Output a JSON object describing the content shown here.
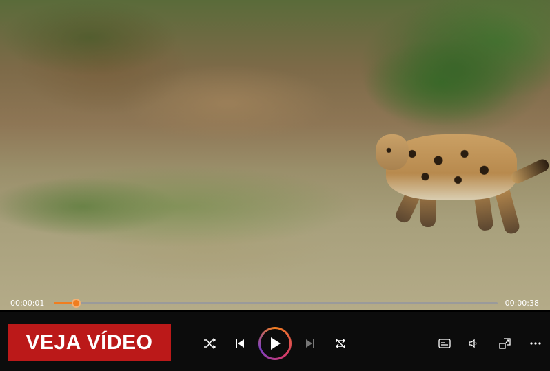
{
  "player": {
    "current_time": "00:00:01",
    "total_time": "00:00:38",
    "progress_fraction": 0.05,
    "accent_color": "#f07d1e"
  },
  "promo": {
    "label": "VEJA VÍDEO",
    "background_color": "#bb1919"
  },
  "controls": {
    "shuffle": "shuffle-icon",
    "previous": "previous-track-icon",
    "play": "play-icon",
    "next": "next-track-icon",
    "repeat": "repeat-icon",
    "captions": "captions-icon",
    "volume": "volume-icon",
    "miniplayer": "miniplayer-icon",
    "more": "more-options-icon"
  }
}
